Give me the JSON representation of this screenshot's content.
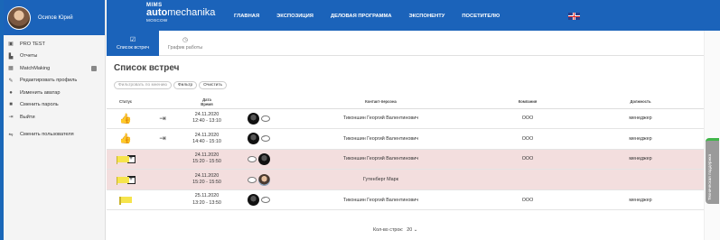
{
  "user": {
    "name": "Осипов Юрий"
  },
  "sidebar": {
    "items": [
      {
        "label": "PRO TEST",
        "icon": "badge-icon"
      },
      {
        "label": "Отчеты",
        "icon": "bar-chart-icon"
      },
      {
        "label": "MatchMaking",
        "icon": "calendar-icon"
      },
      {
        "label": "Редактировать профиль",
        "icon": "pencil-icon"
      },
      {
        "label": "Изменить аватар",
        "icon": "camera-icon"
      },
      {
        "label": "Сменить пароль",
        "icon": "lock-icon"
      },
      {
        "label": "Выйти",
        "icon": "logout-icon"
      },
      {
        "label": "Сменить пользователя",
        "icon": "switch-user-icon"
      }
    ]
  },
  "brand": {
    "line1": "MIMS",
    "line2_bold": "auto",
    "line2_rest": "mechanika",
    "line3": "MOSCOW"
  },
  "nav": [
    "ГЛАВНАЯ",
    "ЭКСПОЗИЦИЯ",
    "ДЕЛОВАЯ ПРОГРАММА",
    "ЭКСПОНЕНТУ",
    "ПОСЕТИТЕЛЮ"
  ],
  "tabs": [
    {
      "label": "Список встреч",
      "icon": "check-icon",
      "active": true
    },
    {
      "label": "График работы",
      "icon": "clock-icon",
      "active": false
    }
  ],
  "page": {
    "title": "Список встреч"
  },
  "filters": {
    "sort_label": "Фильтровать по мнению",
    "filter_label": "Фильтр",
    "clear_label": "Очистить"
  },
  "table": {
    "headers": {
      "status": "Статус",
      "date": "Дата\nВремя",
      "contact": "Контакт-персона",
      "company": "Компания",
      "position": "Должность"
    },
    "rows": [
      {
        "status": "confirmed",
        "enter": true,
        "date": "24.11.2020",
        "time": "12:40 - 13:10",
        "avatar": "dark",
        "contact": "Тиконшин Георгий Валентинович",
        "company": "ООО",
        "position": "менеджер",
        "highlight": false
      },
      {
        "status": "confirmed",
        "enter": true,
        "date": "24.11.2020",
        "time": "14:40 - 15:10",
        "avatar": "dark",
        "contact": "Тиконшин Георгий Валентинович",
        "company": "ООО",
        "position": "менеджер",
        "highlight": false
      },
      {
        "status": "pending",
        "enter": false,
        "date": "24.11.2020",
        "time": "15:20 - 15:50",
        "avatar": "dark",
        "contact": "Тиконшин Георгий Валентинович",
        "company": "ООО",
        "position": "менеджер",
        "highlight": true
      },
      {
        "status": "pending",
        "enter": false,
        "date": "24.11.2020",
        "time": "15:20 - 15:50",
        "avatar": "photo",
        "contact": "Гутенберг Марк",
        "company": "",
        "position": "",
        "highlight": true
      },
      {
        "status": "flag",
        "enter": false,
        "date": "25.11.2020",
        "time": "13:20 - 13:50",
        "avatar": "dark",
        "contact": "Тиконшин Георгий Валентинович",
        "company": "ООО",
        "position": "менеджер",
        "highlight": false
      }
    ]
  },
  "pager": {
    "label": "Кол-во строк:",
    "value": "20"
  },
  "support": {
    "label": "Техническая поддержка"
  },
  "colors": {
    "brand_blue": "#1b63ba",
    "row_highlight": "#f3dede",
    "like_green": "#3a9e2c",
    "flag_yellow": "#f6e44c"
  }
}
